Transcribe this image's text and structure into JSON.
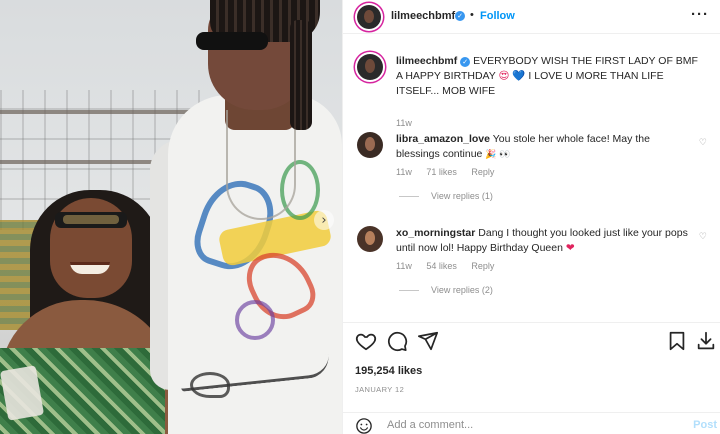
{
  "post": {
    "username": "lilmeechbmf",
    "follow_label": "Follow",
    "more_label": "···",
    "carousel_next": "›"
  },
  "caption": {
    "username": "lilmeechbmf",
    "text": "EVERYBODY WISH THE FIRST LADY OF BMF A HAPPY BIRTHDAY",
    "text_after": "I LOVE U MORE THAN LIFE ITSELF... MOB WIFE",
    "emoji_1": "😍",
    "emoji_2": "💙",
    "age": "11w"
  },
  "comments": [
    {
      "username": "libra_amazon_love",
      "text": "You stole her whole face! May the blessings continue",
      "emoji": "🎉 👀",
      "age": "11w",
      "likes": "71 likes",
      "reply_label": "Reply",
      "view_replies": "View replies (1)"
    },
    {
      "username": "xo_morningstar",
      "text": "Dang I thought you looked just like your pops until now lol! Happy Birthday Queen",
      "emoji": "❤",
      "age": "11w",
      "likes": "54 likes",
      "reply_label": "Reply",
      "view_replies": "View replies (2)"
    }
  ],
  "engagement": {
    "likes": "195,254 likes",
    "date": "JANUARY 12"
  },
  "comment_box": {
    "placeholder": "Add a comment...",
    "post_label": "Post"
  },
  "icons": {
    "like": "heart-icon",
    "comment": "comment-icon",
    "share": "share-icon",
    "save": "bookmark-icon",
    "download": "download-icon",
    "emoji": "emoji-icon",
    "verified": "verified-icon"
  },
  "colors": {
    "link_blue": "#0095f6",
    "muted": "#8e8e8e",
    "text": "#262626",
    "story_ring": "#d6249f"
  }
}
